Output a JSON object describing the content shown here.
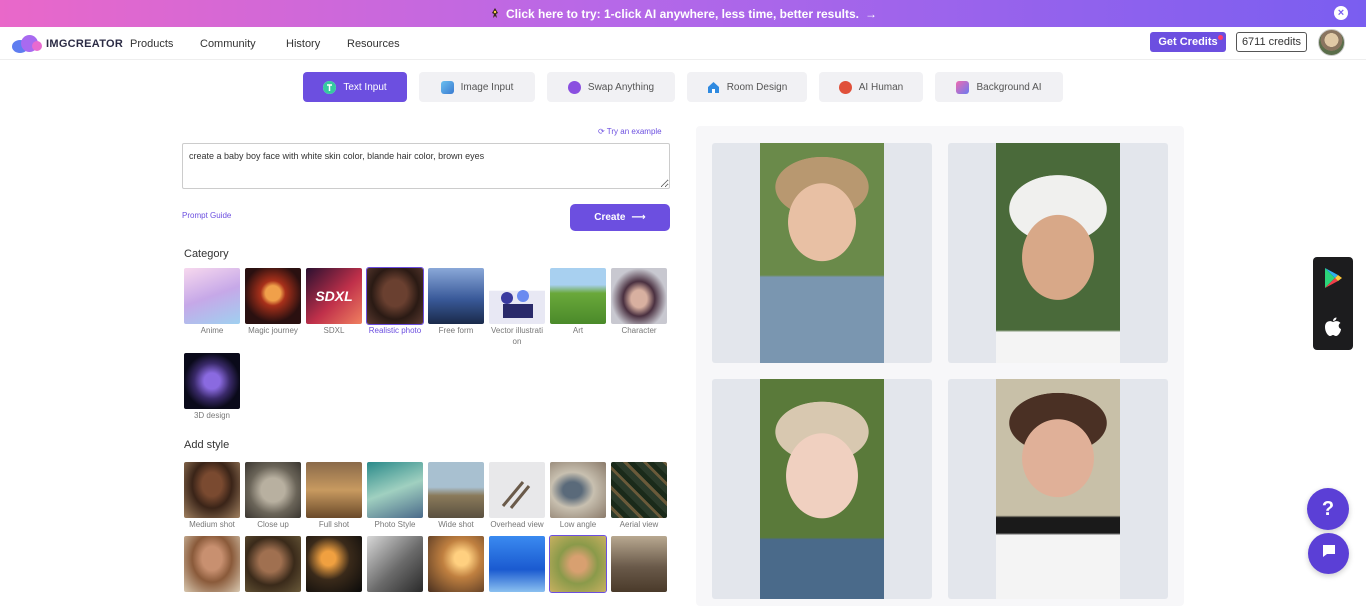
{
  "promo": {
    "text": "Click here to try: 1-click AI anywhere, less time, better results."
  },
  "nav": {
    "logo": "IMGCREATOR",
    "links": [
      "Products",
      "Community",
      "History",
      "Resources"
    ],
    "get_credits": "Get Credits",
    "credits": "6711 credits"
  },
  "tabs": [
    {
      "label": "Text Input",
      "icon": "text-input-icon",
      "active": true
    },
    {
      "label": "Image Input",
      "icon": "image-input-icon"
    },
    {
      "label": "Swap Anything",
      "icon": "swap-icon"
    },
    {
      "label": "Room Design",
      "icon": "house-icon"
    },
    {
      "label": "AI Human",
      "icon": "ai-human-icon"
    },
    {
      "label": "Background AI",
      "icon": "background-icon"
    }
  ],
  "editor": {
    "try_example": "Try an example",
    "prompt": "create a baby boy face with white skin color, blande hair color, brown eyes",
    "prompt_guide": "Prompt Guide",
    "create": "Create"
  },
  "category": {
    "title": "Category",
    "items": [
      {
        "label": "Anime"
      },
      {
        "label": "Magic journey"
      },
      {
        "label": "SDXL"
      },
      {
        "label": "Realistic photo",
        "selected": true
      },
      {
        "label": "Free form"
      },
      {
        "label": "Vector illustration"
      },
      {
        "label": "Art"
      },
      {
        "label": "Character"
      },
      {
        "label": "3D design"
      }
    ]
  },
  "style": {
    "title": "Add style",
    "items": [
      {
        "label": "Medium shot"
      },
      {
        "label": "Close up"
      },
      {
        "label": "Full shot"
      },
      {
        "label": "Photo Style"
      },
      {
        "label": "Wide shot"
      },
      {
        "label": "Overhead view"
      },
      {
        "label": "Low angle"
      },
      {
        "label": "Aerial view"
      }
    ]
  },
  "colors": {
    "accent": "#6c4fe0",
    "help": "#5b3fd6"
  }
}
